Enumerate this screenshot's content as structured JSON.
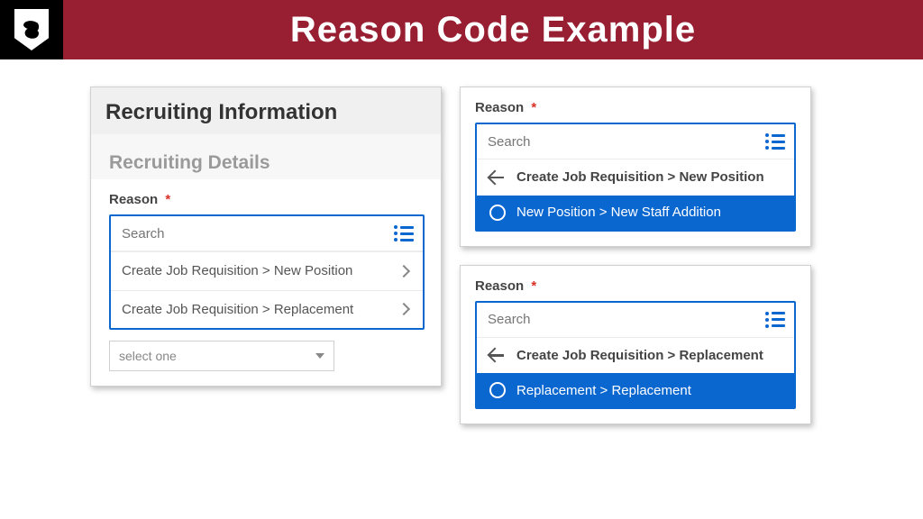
{
  "header": {
    "title": "Reason Code Example"
  },
  "left_panel": {
    "title": "Recruiting Information",
    "subtitle": "Recruiting Details",
    "field_label": "Reason",
    "search_placeholder": "Search",
    "options": [
      "Create Job Requisition > New Position",
      "Create Job Requisition > Replacement"
    ],
    "select_placeholder": "select one"
  },
  "right_panel_top": {
    "field_label": "Reason",
    "search_placeholder": "Search",
    "nav_breadcrumb": "Create Job Requisition > New Position",
    "selected_option": "New Position > New Staff Addition"
  },
  "right_panel_bottom": {
    "field_label": "Reason",
    "search_placeholder": "Search",
    "nav_breadcrumb": "Create Job Requisition > Replacement",
    "selected_option": "Replacement > Replacement"
  }
}
